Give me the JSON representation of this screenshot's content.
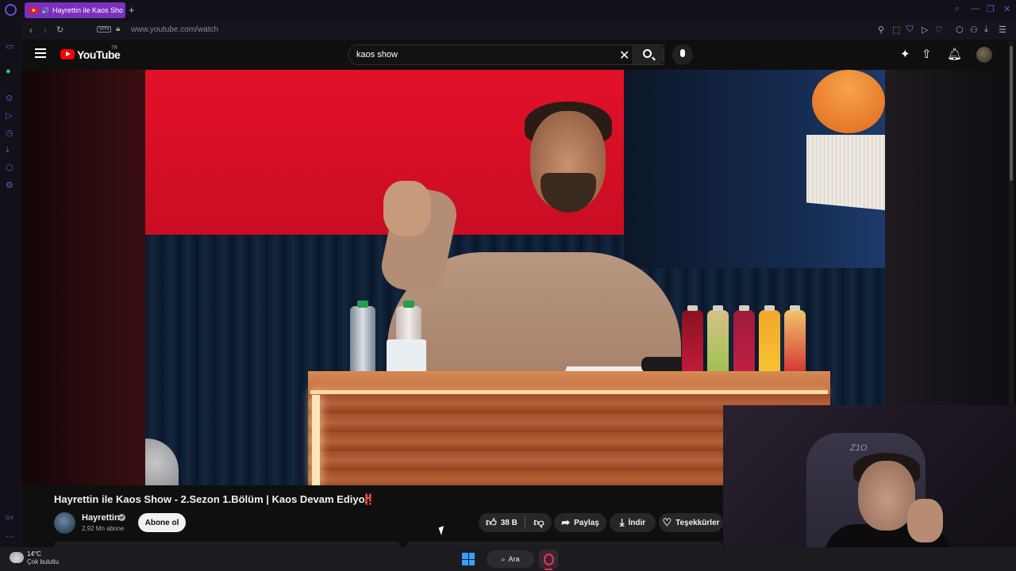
{
  "browser": {
    "tab_title": "Hayrettin ile Kaos Sho",
    "new_tab_label": "+",
    "vpn_badge": "VPN",
    "url": "www.youtube.com/watch",
    "accent_color": "#7b2fbe",
    "sidebar_badge": "GX"
  },
  "youtube": {
    "logo_text": "YouTube",
    "region": "TR",
    "search": {
      "value": "kaos show"
    }
  },
  "video": {
    "title": "Hayrettin ile Kaos Show - 2.Sezon 1.Bölüm | Kaos Devam Ediyor",
    "title_emoji": "‼️",
    "channel": {
      "name": "Hayrettin",
      "subscribers": "2,92 Mn abone",
      "verified": true
    },
    "subscribe_label": "Abone ol",
    "actions": {
      "likes": "38 B",
      "share": "Paylaş",
      "download": "İndir",
      "thanks": "Teşekkürler"
    }
  },
  "webcam": {
    "chair_logo": "Z1O"
  },
  "taskbar": {
    "weather": {
      "temp": "14°C",
      "desc": "Çok bulutlu"
    },
    "search_label": "Ara"
  }
}
